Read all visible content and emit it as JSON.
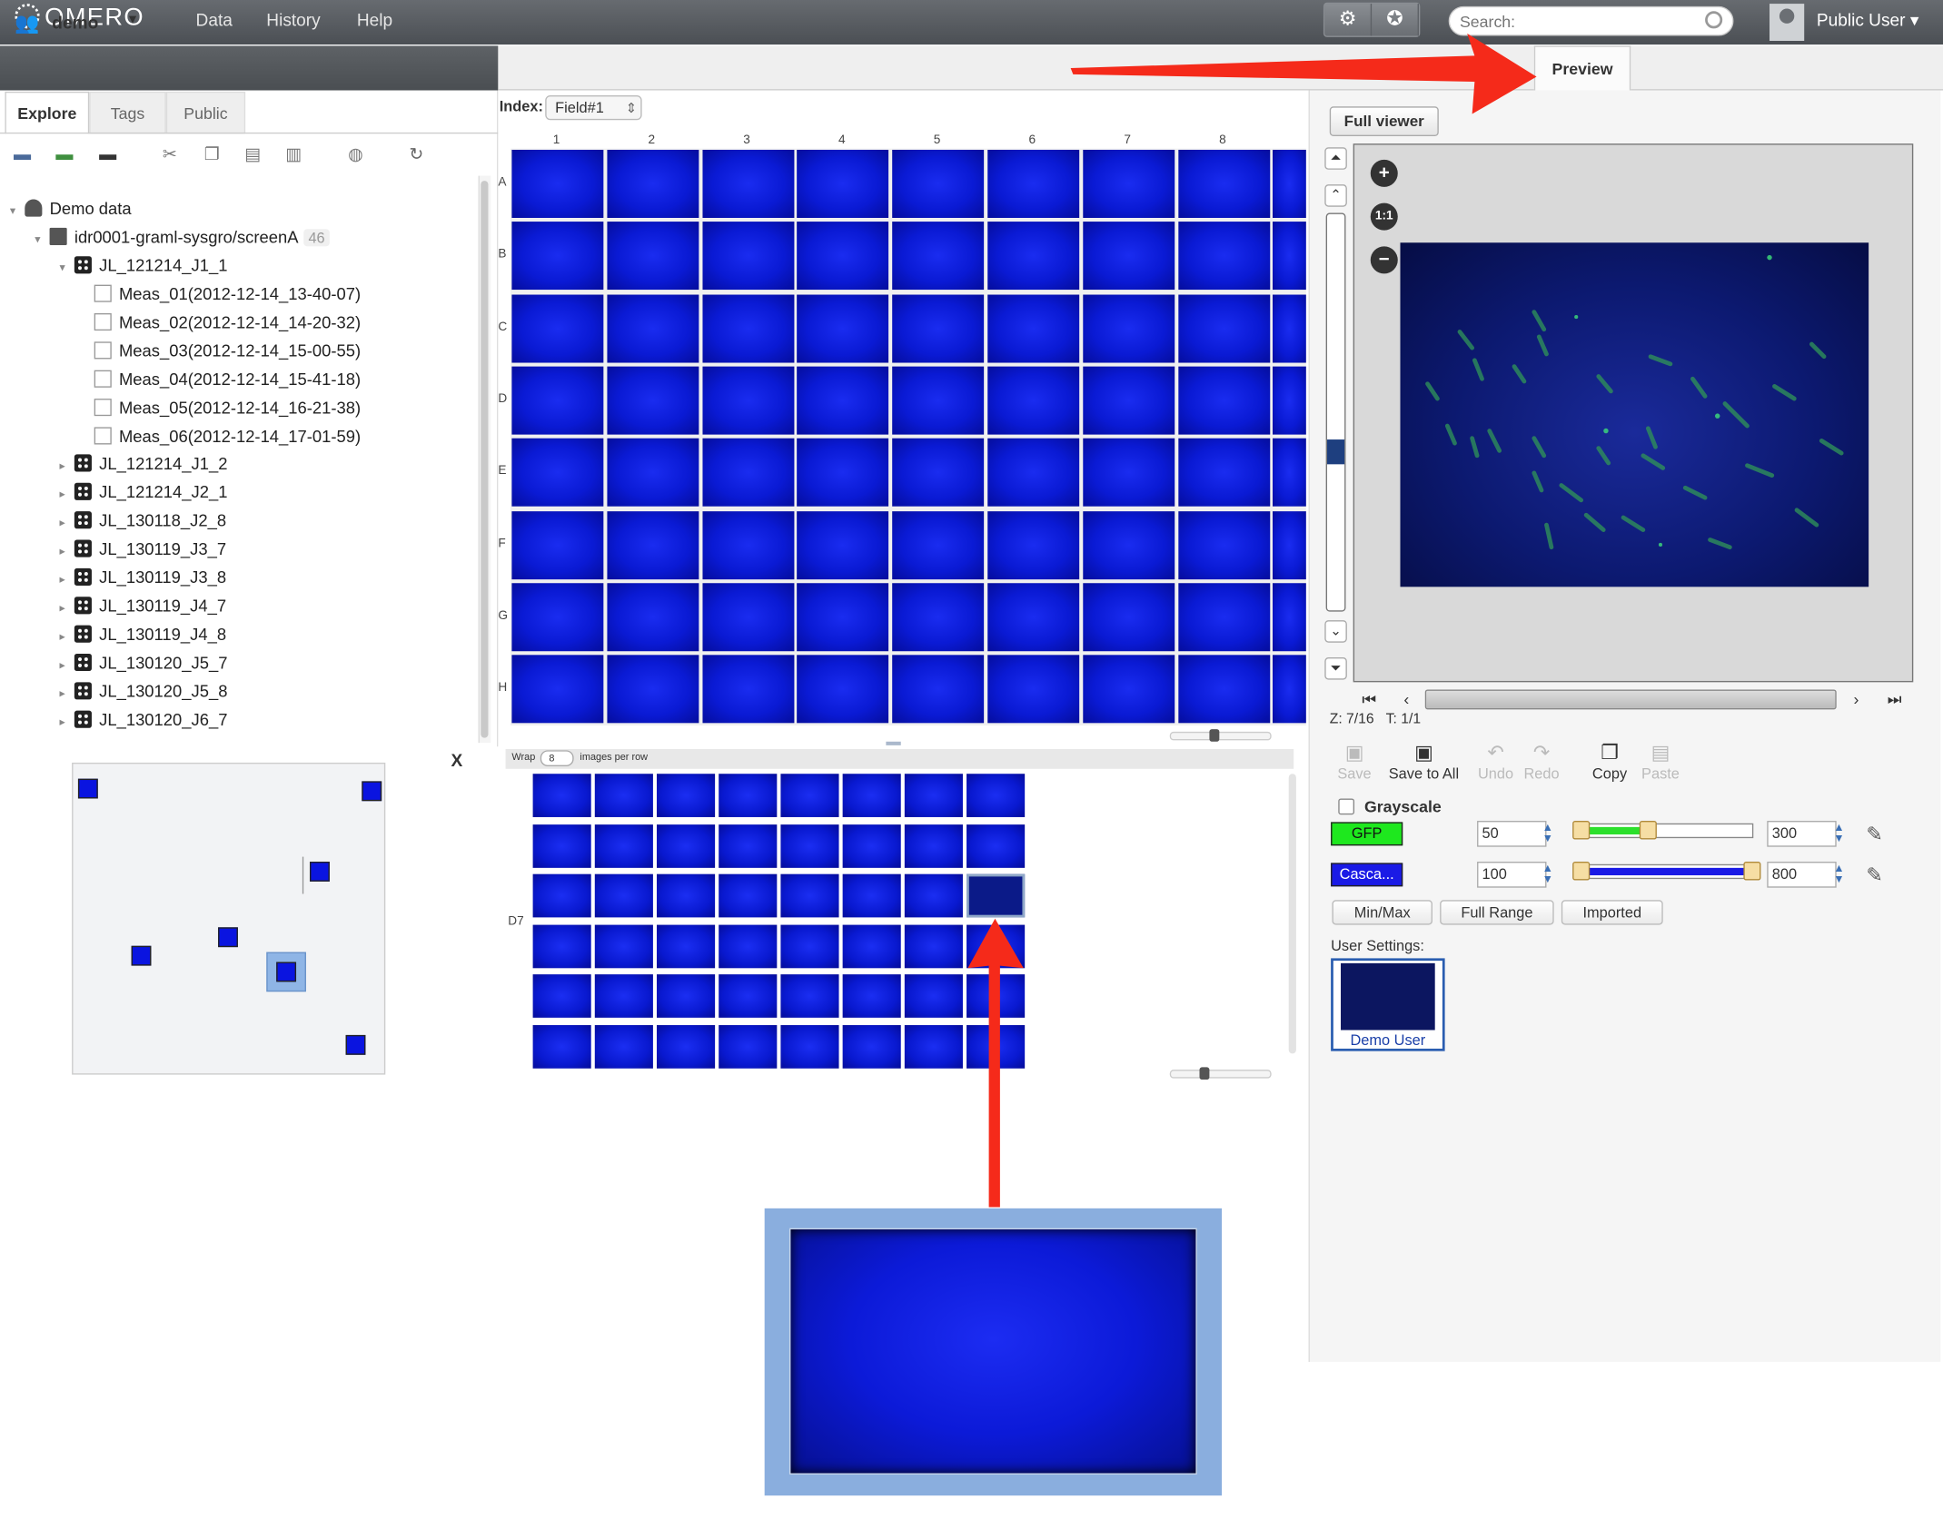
{
  "topbar": {
    "logo": "OMERO",
    "nav": [
      "Data",
      "History",
      "Help"
    ],
    "search_placeholder": "Search:",
    "user": "Public User",
    "user_caret": "▾"
  },
  "group": {
    "name": "demo",
    "caret": "▾"
  },
  "left_tabs": [
    "Explore",
    "Tags",
    "Public"
  ],
  "tree": {
    "root": "Demo data",
    "screen": {
      "name": "idr0001-graml-sysgro/screenA",
      "count": "46"
    },
    "expanded_plate": "JL_121214_J1_1",
    "acquisitions": [
      "Meas_01(2012-12-14_13-40-07)",
      "Meas_02(2012-12-14_14-20-32)",
      "Meas_03(2012-12-14_15-00-55)",
      "Meas_04(2012-12-14_15-41-18)",
      "Meas_05(2012-12-14_16-21-38)",
      "Meas_06(2012-12-14_17-01-59)"
    ],
    "plates": [
      "JL_121214_J1_2",
      "JL_121214_J2_1",
      "JL_130118_J2_8",
      "JL_130119_J3_7",
      "JL_130119_J3_8",
      "JL_130119_J4_7",
      "JL_130119_J4_8",
      "JL_130120_J5_7",
      "JL_130120_J5_8",
      "JL_130120_J6_7"
    ]
  },
  "map": {
    "close": "X"
  },
  "plate": {
    "index_label": "Index:",
    "index_value": "Field#1",
    "columns": [
      "1",
      "2",
      "3",
      "4",
      "5",
      "6",
      "7",
      "8"
    ],
    "rows": [
      "A",
      "B",
      "C",
      "D",
      "E",
      "F",
      "G",
      "H"
    ]
  },
  "well_images": {
    "wrap_label": "Wrap",
    "wrap_value": "8",
    "wrap_suffix": "images per row",
    "well_label": "D7"
  },
  "right": {
    "tab": "Preview",
    "full_viewer": "Full viewer",
    "zoom_in": "+",
    "zoom_one": "1:1",
    "zoom_out": "−",
    "z_readout": "Z: 7/16",
    "t_readout": "T: 1/1",
    "actions": [
      "Save",
      "Save to All",
      "Undo",
      "Redo",
      "Copy",
      "Paste"
    ],
    "grayscale": "Grayscale",
    "channels": [
      {
        "name": "GFP",
        "min": "50",
        "max": "300",
        "color": "#1ee81e"
      },
      {
        "name": "Casca...",
        "min": "100",
        "max": "800",
        "color": "#1a1ae6"
      }
    ],
    "range_buttons": [
      "Min/Max",
      "Full Range",
      "Imported"
    ],
    "user_settings_label": "User Settings:",
    "user_settings_name": "Demo User"
  },
  "colors": {
    "arrow": "#f52a1a",
    "accent": "#2a5db0"
  }
}
